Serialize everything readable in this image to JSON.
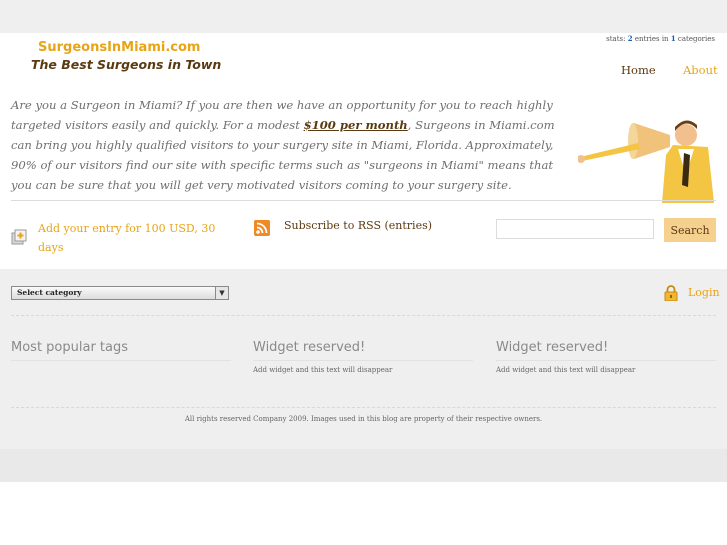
{
  "site": {
    "logo_name": "SurgeonsInMiami.com",
    "tagline": "The Best Surgeons in Town"
  },
  "stats": {
    "prefix": "stats:",
    "entries": "2",
    "mid": "entries in",
    "categories": "1",
    "suffix": "categories"
  },
  "nav": {
    "home": "Home",
    "about": "About"
  },
  "intro": {
    "part1": "Are you a Surgeon in Miami? If you are then we have an opportunity for you to reach highly targeted visitors easily and quickly. For a modest ",
    "highlight": "$100 per month",
    "part2": ", Surgeons in Miami.com can bring you highly qualified visitors to your surgery site in Miami, Florida. Approximately, 90% of our visitors find our site with specific terms such as \"surgeons in Miami\" means that you can be sure that you will get very motivated visitors coming to your surgery site."
  },
  "actions": {
    "add_entry": "Add your entry for 100 USD, 30 days",
    "rss": "Subscribe to RSS (entries)",
    "search_value": "",
    "search_button": "Search"
  },
  "category_select": {
    "selected": "Select category"
  },
  "login": "Login",
  "widgets": [
    {
      "title": "Most popular tags",
      "text": ""
    },
    {
      "title": "Widget reserved!",
      "text": "Add widget and this text will disappear"
    },
    {
      "title": "Widget reserved!",
      "text": "Add widget and this text will disappear"
    }
  ],
  "footer": "All rights reserved Company 2009. Images used in this blog are property of their respective owners.",
  "colors": {
    "accent": "#e8a416",
    "brown": "#5a3a12",
    "link_blue": "#1a5fa8",
    "band_gray": "#efefef"
  },
  "icons": [
    "add-entry-icon",
    "rss-icon",
    "lock-icon",
    "dropdown-arrow-icon"
  ]
}
